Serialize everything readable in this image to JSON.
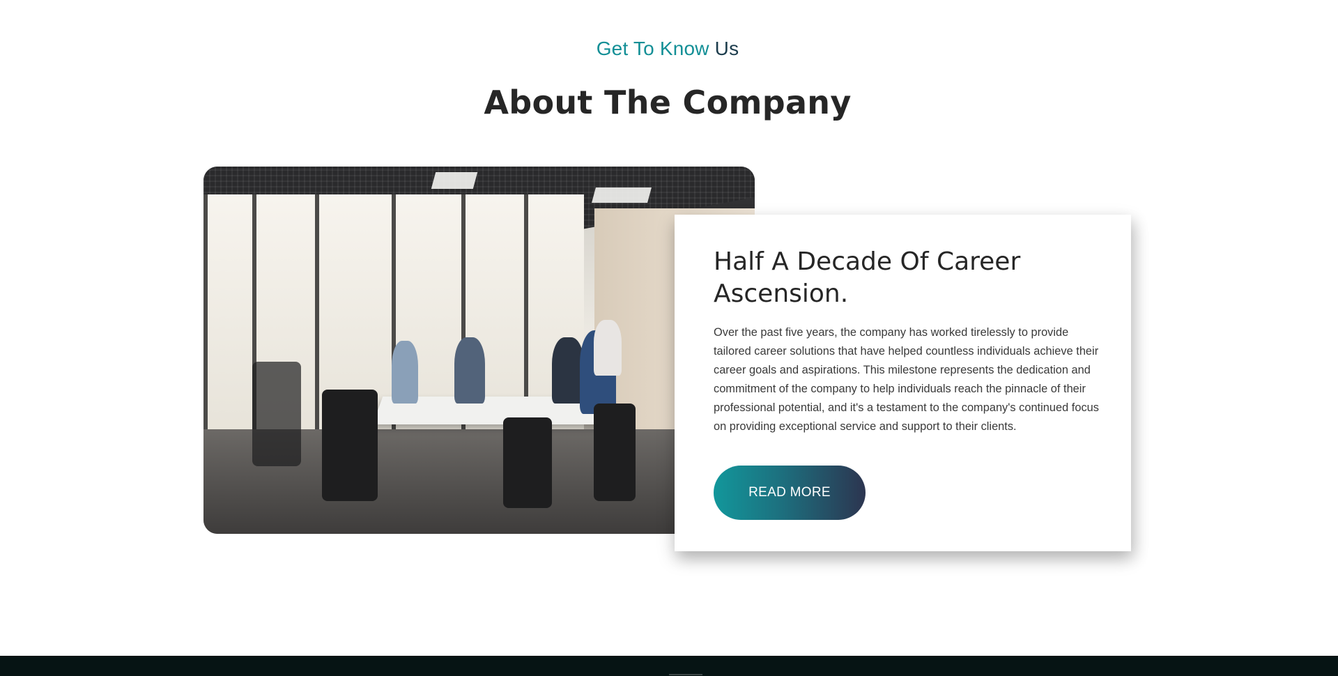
{
  "section": {
    "eyebrow_part1": "Get To Know",
    "eyebrow_part2": "Us",
    "title": "About The Company"
  },
  "card": {
    "title": "Half A Decade Of Career Ascension.",
    "body": "Over the past five years, the company has worked tirelessly to provide tailored career solutions that have helped countless individuals achieve their career goals and aspirations. This milestone represents the dedication and commitment of the company to help individuals reach the pinnacle of their professional potential, and it's a testament to the company's continued focus on providing exceptional service and support to their clients.",
    "button_label": "READ MORE"
  },
  "photo": {
    "subject": "office-meeting-photo"
  },
  "colors": {
    "accent_teal": "#138f96",
    "heading_dark": "#262626",
    "button_gradient_start": "#12979b",
    "button_gradient_end": "#2c3550",
    "footer_bg": "#061414"
  }
}
